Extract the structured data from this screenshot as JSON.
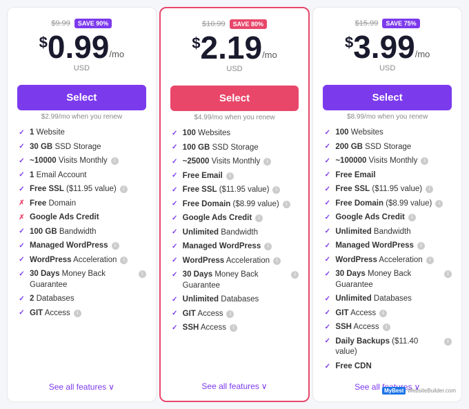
{
  "plans": [
    {
      "id": "basic",
      "original_price": "$9.99",
      "save_badge": "SAVE 90%",
      "badge_class": "purple",
      "price_dollar": "$",
      "price_amount": "0.99",
      "price_mo": "/mo",
      "price_currency": "USD",
      "select_label": "Select",
      "btn_class": "purple",
      "renew_text": "$2.99/mo when you renew",
      "features": [
        {
          "icon": "check",
          "text": "1 Website",
          "bold": "1",
          "info": false
        },
        {
          "icon": "check",
          "text": "30 GB SSD Storage",
          "bold": "30 GB",
          "info": false
        },
        {
          "icon": "check",
          "text": "~10000 Visits Monthly",
          "bold": "~10000",
          "info": true
        },
        {
          "icon": "check",
          "text": "1 Email Account",
          "bold": "1",
          "info": false
        },
        {
          "icon": "check",
          "text": "Free SSL ($11.95 value)",
          "bold": "Free SSL",
          "info": true
        },
        {
          "icon": "cross",
          "text": "Free Domain",
          "bold": "Free",
          "info": false
        },
        {
          "icon": "cross",
          "text": "Google Ads Credit",
          "bold": "Google Ads Credit",
          "info": false
        },
        {
          "icon": "check",
          "text": "100 GB Bandwidth",
          "bold": "100 GB",
          "info": false
        },
        {
          "icon": "check",
          "text": "Managed WordPress",
          "bold": "Managed WordPress",
          "info": true
        },
        {
          "icon": "check",
          "text": "WordPress Acceleration",
          "bold": "WordPress",
          "info": true
        },
        {
          "icon": "check",
          "text": "30 Days Money Back Guarantee",
          "bold": "30 Days",
          "info": true
        },
        {
          "icon": "check",
          "text": "2 Databases",
          "bold": "2",
          "info": false
        },
        {
          "icon": "check",
          "text": "GIT Access",
          "bold": "GIT",
          "info": true
        }
      ],
      "see_all_label": "See all features",
      "is_middle": false
    },
    {
      "id": "premium",
      "original_price": "$10.99",
      "save_badge": "SAVE 80%",
      "badge_class": "pink",
      "price_dollar": "$",
      "price_amount": "2.19",
      "price_mo": "/mo",
      "price_currency": "USD",
      "select_label": "Select",
      "btn_class": "pink",
      "renew_text": "$4.99/mo when you renew",
      "features": [
        {
          "icon": "check",
          "text": "100 Websites",
          "bold": "100",
          "info": false
        },
        {
          "icon": "check",
          "text": "100 GB SSD Storage",
          "bold": "100 GB",
          "info": false
        },
        {
          "icon": "check",
          "text": "~25000 Visits Monthly",
          "bold": "~25000",
          "info": true
        },
        {
          "icon": "check",
          "text": "Free Email",
          "bold": "Free Email",
          "info": true
        },
        {
          "icon": "check",
          "text": "Free SSL ($11.95 value)",
          "bold": "Free SSL",
          "info": true
        },
        {
          "icon": "check",
          "text": "Free Domain ($8.99 value)",
          "bold": "Free Domain",
          "info": true
        },
        {
          "icon": "check",
          "text": "Google Ads Credit",
          "bold": "Google Ads Credit",
          "info": true
        },
        {
          "icon": "check",
          "text": "Unlimited Bandwidth",
          "bold": "Unlimited",
          "info": false
        },
        {
          "icon": "check",
          "text": "Managed WordPress",
          "bold": "Managed WordPress",
          "info": true
        },
        {
          "icon": "check",
          "text": "WordPress Acceleration",
          "bold": "WordPress",
          "info": true
        },
        {
          "icon": "check",
          "text": "30 Days Money Back Guarantee",
          "bold": "30 Days",
          "info": true
        },
        {
          "icon": "check",
          "text": "Unlimited Databases",
          "bold": "Unlimited",
          "info": false
        },
        {
          "icon": "check",
          "text": "GIT Access",
          "bold": "GIT",
          "info": true
        },
        {
          "icon": "check",
          "text": "SSH Access",
          "bold": "SSH",
          "info": true
        }
      ],
      "see_all_label": "See all features",
      "is_middle": true
    },
    {
      "id": "business",
      "original_price": "$15.99",
      "save_badge": "SAVE 75%",
      "badge_class": "purple",
      "price_dollar": "$",
      "price_amount": "3.99",
      "price_mo": "/mo",
      "price_currency": "USD",
      "select_label": "Select",
      "btn_class": "purple",
      "renew_text": "$8.99/mo when you renew",
      "features": [
        {
          "icon": "check",
          "text": "100 Websites",
          "bold": "100",
          "info": false
        },
        {
          "icon": "check",
          "text": "200 GB SSD Storage",
          "bold": "200 GB",
          "info": false
        },
        {
          "icon": "check",
          "text": "~100000 Visits Monthly",
          "bold": "~100000",
          "info": true
        },
        {
          "icon": "check",
          "text": "Free Email",
          "bold": "Free Email",
          "info": false
        },
        {
          "icon": "check",
          "text": "Free SSL ($11.95 value)",
          "bold": "Free SSL",
          "info": true
        },
        {
          "icon": "check",
          "text": "Free Domain ($8.99 value)",
          "bold": "Free Domain",
          "info": true
        },
        {
          "icon": "check",
          "text": "Google Ads Credit",
          "bold": "Google Ads Credit",
          "info": true
        },
        {
          "icon": "check",
          "text": "Unlimited Bandwidth",
          "bold": "Unlimited",
          "info": false
        },
        {
          "icon": "check",
          "text": "Managed WordPress",
          "bold": "Managed WordPress",
          "info": true
        },
        {
          "icon": "check",
          "text": "WordPress Acceleration",
          "bold": "WordPress",
          "info": true
        },
        {
          "icon": "check",
          "text": "30 Days Money Back Guarantee",
          "bold": "30 Days",
          "info": true
        },
        {
          "icon": "check",
          "text": "Unlimited Databases",
          "bold": "Unlimited",
          "info": false
        },
        {
          "icon": "check",
          "text": "GIT Access",
          "bold": "GIT",
          "info": true
        },
        {
          "icon": "check",
          "text": "SSH Access",
          "bold": "SSH",
          "info": true
        },
        {
          "icon": "check",
          "text": "Daily Backups ($11.40 value)",
          "bold": "Daily Backups",
          "info": true
        },
        {
          "icon": "check",
          "text": "Free CDN",
          "bold": "Free CDN",
          "info": false
        }
      ],
      "see_all_label": "See all features",
      "is_middle": false
    }
  ],
  "watermark": {
    "label": "MyBest",
    "sub": "WebsiteBuilder.com"
  }
}
